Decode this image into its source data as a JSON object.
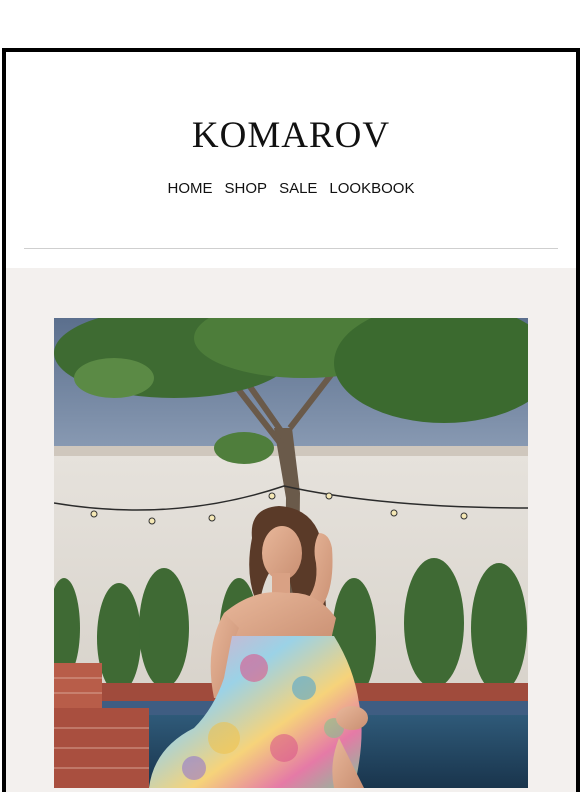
{
  "brand": {
    "name": "KOMAROV"
  },
  "nav": {
    "items": [
      {
        "label": "HOME"
      },
      {
        "label": "SHOP"
      },
      {
        "label": "SALE"
      },
      {
        "label": "LOOKBOOK"
      }
    ]
  },
  "hero": {
    "image_icon": "lifestyle-photo"
  },
  "colors": {
    "frame_border": "#000000",
    "hero_background": "#f3f0ee"
  }
}
